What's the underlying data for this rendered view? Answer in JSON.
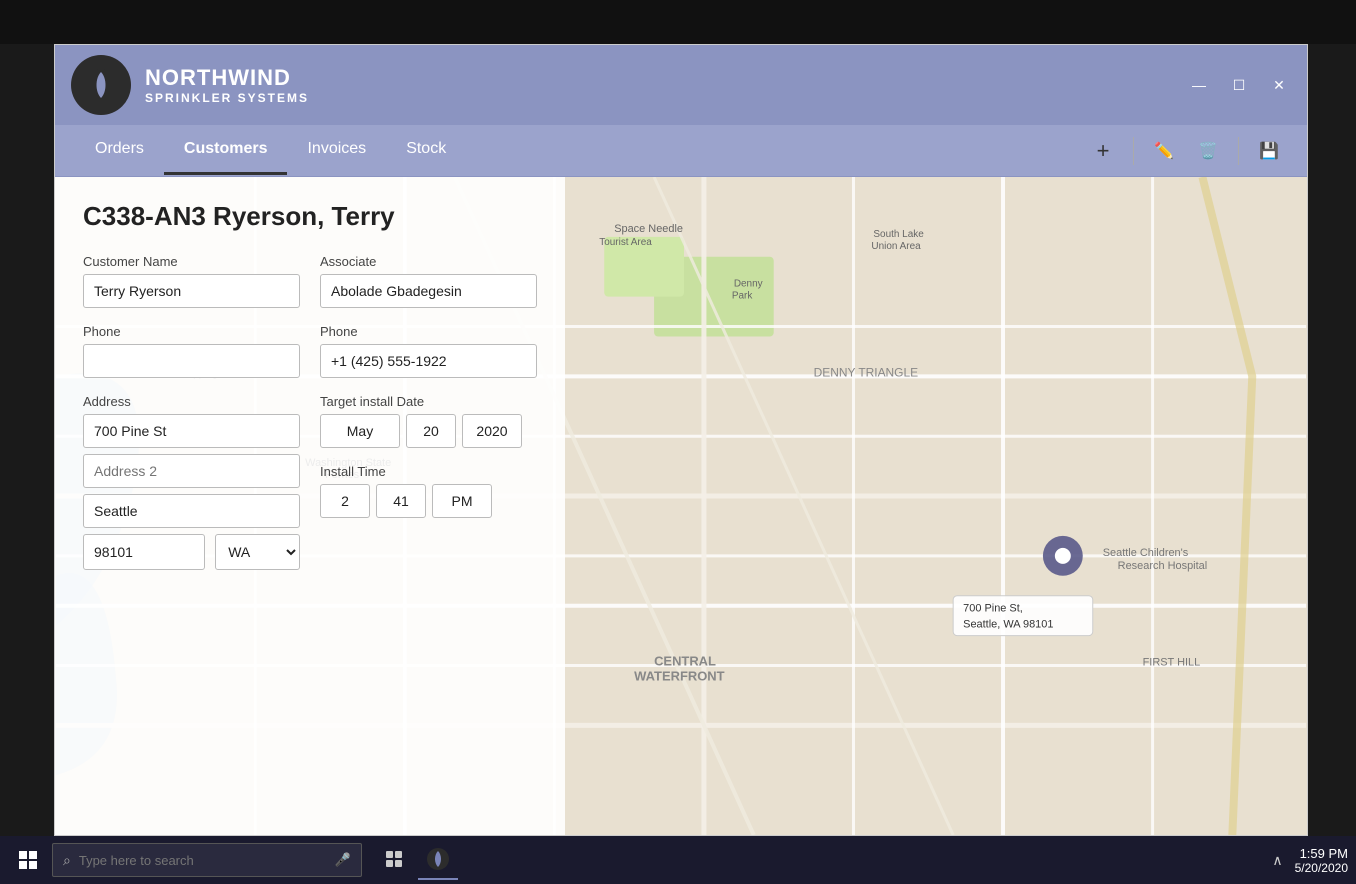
{
  "app": {
    "name": "NORTHWIND",
    "subtitle": "SPRINKLER SYSTEMS"
  },
  "window": {
    "controls": {
      "minimize": "—",
      "maximize": "☐",
      "close": "✕"
    }
  },
  "nav": {
    "items": [
      {
        "id": "orders",
        "label": "Orders",
        "active": false
      },
      {
        "id": "customers",
        "label": "Customers",
        "active": true
      },
      {
        "id": "invoices",
        "label": "Invoices",
        "active": false
      },
      {
        "id": "stock",
        "label": "Stock",
        "active": false
      }
    ],
    "actions": {
      "add": "+",
      "edit": "✏",
      "delete": "🗑",
      "save": "💾"
    }
  },
  "record": {
    "title": "C338-AN3 Ryerson, Terry",
    "customer_name_label": "Customer Name",
    "customer_name_value": "Terry Ryerson",
    "associate_label": "Associate",
    "associate_value": "Abolade Gbadegesin",
    "phone_label_1": "Phone",
    "phone_value_1": "",
    "phone_label_2": "Phone",
    "phone_value_2": "+1 (425) 555-1922",
    "address_label": "Address",
    "address_value": "700 Pine St",
    "address2_placeholder": "Address 2",
    "city_value": "Seattle",
    "zip_value": "98101",
    "state_value": "WA",
    "target_install_label": "Target install Date",
    "date_month": "May",
    "date_day": "20",
    "date_year": "2020",
    "install_time_label": "Install Time",
    "time_hour": "2",
    "time_minute": "41",
    "time_ampm": "PM"
  },
  "map": {
    "pin_label_line1": "700 Pine St,",
    "pin_label_line2": "Seattle, WA 98101"
  },
  "taskbar": {
    "search_placeholder": "Type here to search",
    "time": "1:59 PM",
    "date": "5/20/2020"
  }
}
